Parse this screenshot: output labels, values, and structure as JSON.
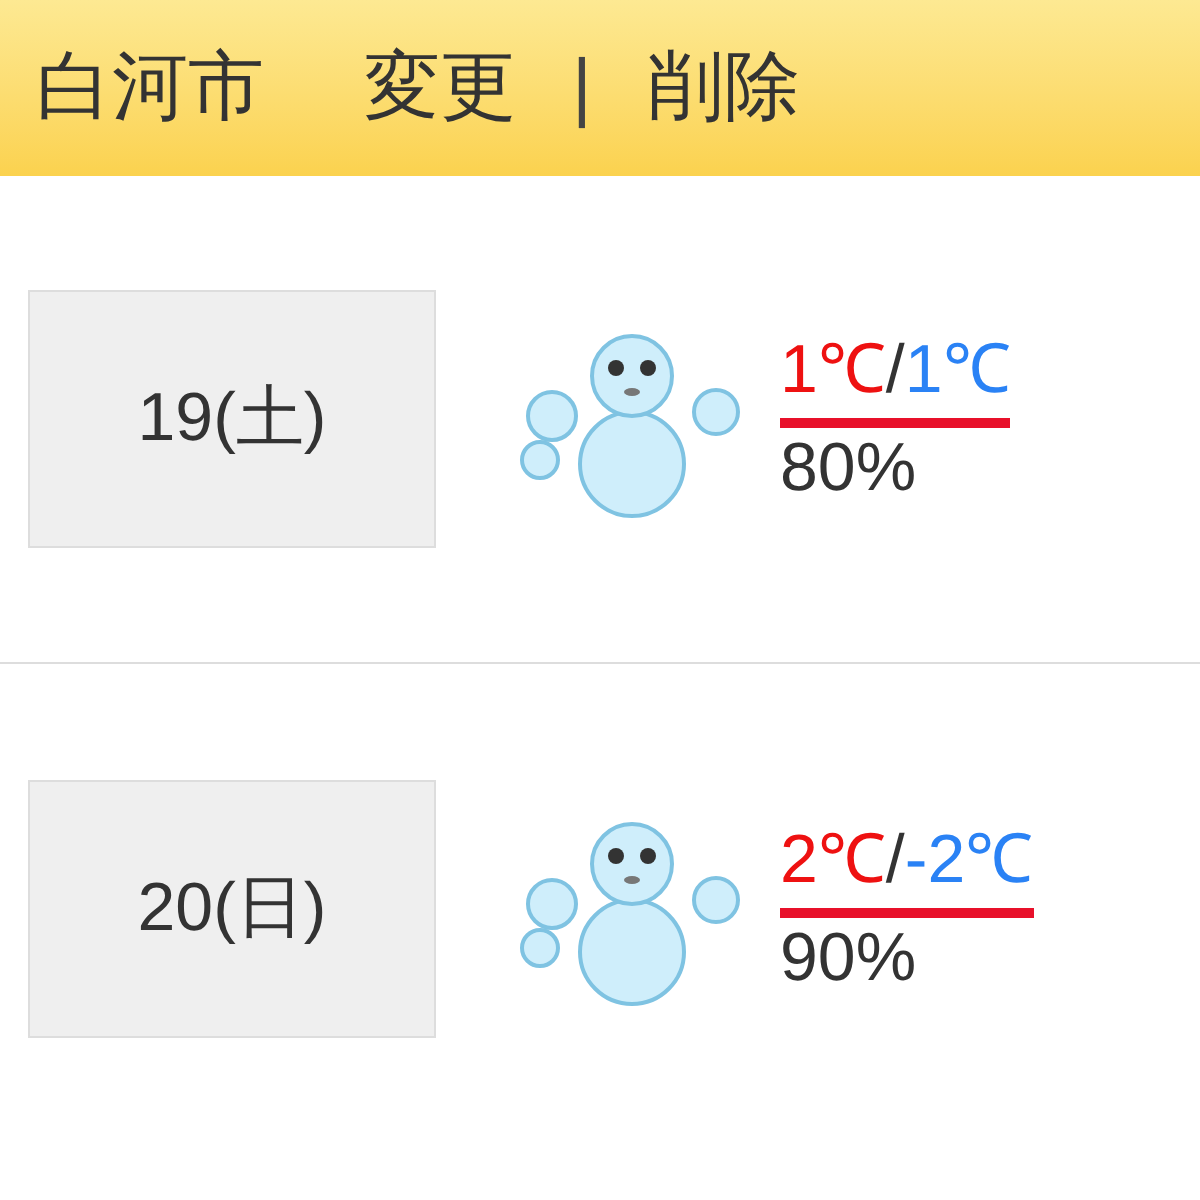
{
  "header": {
    "city": "白河市",
    "links": [
      "変更",
      "削除"
    ],
    "separator": "|"
  },
  "days": [
    {
      "date": "19(土)",
      "high": "1℃",
      "slash": "/",
      "low": "1℃",
      "humidity": "80%"
    },
    {
      "date": "20(日)",
      "high": "2℃",
      "slash": "/",
      "low": "-2℃",
      "humidity": "90%"
    }
  ]
}
